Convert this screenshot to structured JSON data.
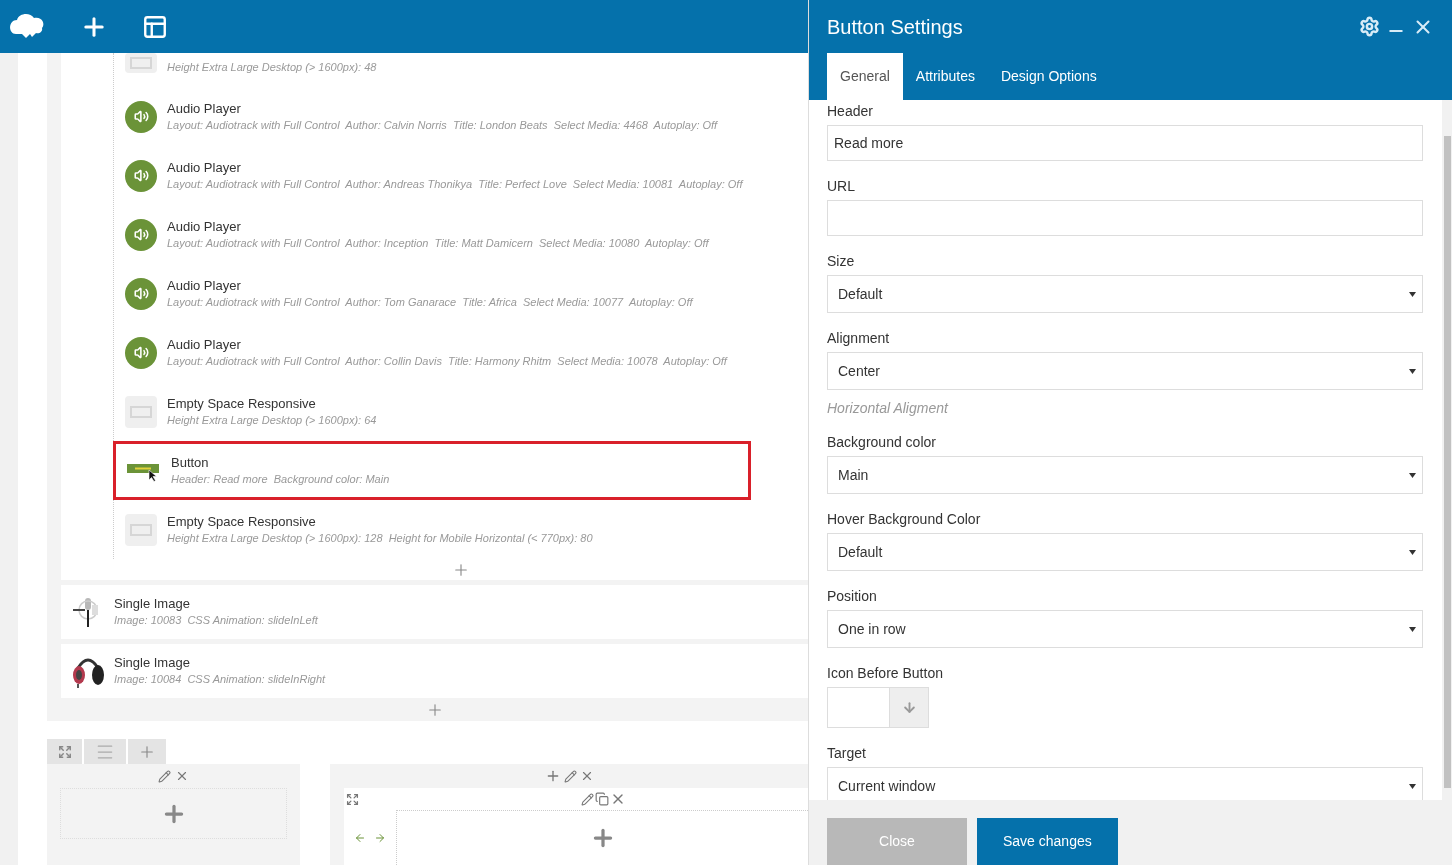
{
  "elements": [
    {
      "kind": "empty_space",
      "detail": "Height Extra Large Desktop (> 1600px): 48",
      "highlighted": false
    },
    {
      "kind": "audio",
      "title": "Audio Player",
      "detail": "Layout: Audiotrack with Full Control  Author: Calvin Norris  Title: London Beats  Select Media: 4468  Autoplay: Off",
      "highlighted": false
    },
    {
      "kind": "audio",
      "title": "Audio Player",
      "detail": "Layout: Audiotrack with Full Control  Author: Andreas Thonikya  Title: Perfect Love  Select Media: 10081  Autoplay: Off",
      "highlighted": false
    },
    {
      "kind": "audio",
      "title": "Audio Player",
      "detail": "Layout: Audiotrack with Full Control  Author: Inception  Title: Matt Damicern  Select Media: 10080  Autoplay: Off",
      "highlighted": false
    },
    {
      "kind": "audio",
      "title": "Audio Player",
      "detail": "Layout: Audiotrack with Full Control  Author: Tom Ganarace  Title: Africa  Select Media: 10077  Autoplay: Off",
      "highlighted": false
    },
    {
      "kind": "audio",
      "title": "Audio Player",
      "detail": "Layout: Audiotrack with Full Control  Author: Collin Davis  Title: Harmony Rhitm  Select Media: 10078  Autoplay: Off",
      "highlighted": false
    },
    {
      "kind": "empty_space",
      "title": "Empty Space Responsive",
      "detail": "Height Extra Large Desktop (> 1600px): 64",
      "highlighted": false
    },
    {
      "kind": "button",
      "title": "Button",
      "detail": "Header: Read more  Background color: Main",
      "highlighted": true
    },
    {
      "kind": "empty_space",
      "title": "Empty Space Responsive",
      "detail": "Height Extra Large Desktop (> 1600px): 128  Height for Mobile Horizontal (< 770px): 80",
      "highlighted": false
    }
  ],
  "single_images": [
    {
      "title": "Single Image",
      "detail": "Image: 10083  CSS Animation: slideInLeft"
    },
    {
      "title": "Single Image",
      "detail": "Image: 10084  CSS Animation: slideInRight"
    }
  ],
  "panel": {
    "title": "Button Settings",
    "tabs": [
      {
        "label": "General",
        "selected": true
      },
      {
        "label": "Attributes",
        "selected": false
      },
      {
        "label": "Design Options",
        "selected": false
      }
    ],
    "fields": [
      {
        "kind": "text",
        "label": "Header",
        "value": "Read more"
      },
      {
        "kind": "text",
        "label": "URL"
      },
      {
        "kind": "select",
        "label": "Size",
        "value": "Default"
      },
      {
        "kind": "select",
        "label": "Alignment",
        "value": "Center",
        "help": "Horizontal Aligment"
      },
      {
        "kind": "select",
        "label": "Background color",
        "value": "Main"
      },
      {
        "kind": "select",
        "label": "Hover Background Color",
        "value": "Default"
      },
      {
        "kind": "select",
        "label": "Position",
        "value": "One in row"
      },
      {
        "kind": "icon_picker",
        "label": "Icon Before Button"
      },
      {
        "kind": "select",
        "label": "Target",
        "value": "Current window"
      }
    ],
    "buttons": [
      {
        "label": "Close",
        "kind": "secondary"
      },
      {
        "label": "Save changes",
        "kind": "primary"
      }
    ]
  }
}
